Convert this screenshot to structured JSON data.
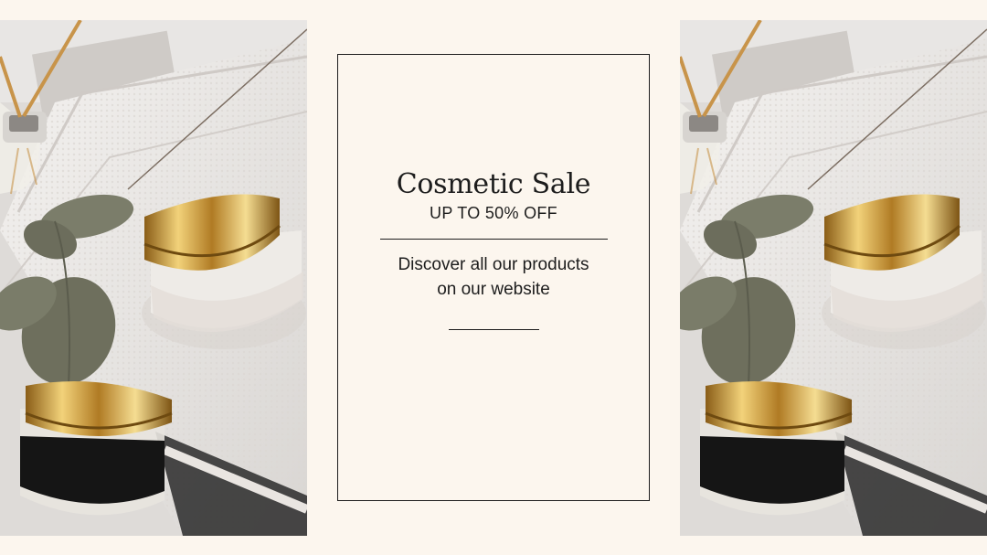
{
  "promo": {
    "title": "Cosmetic Sale",
    "subtitle": "UP TO 50% OFF",
    "line1": "Discover all our products",
    "line2": "on our website"
  },
  "colors": {
    "background": "#fcf6ee",
    "text": "#1d1d1d",
    "gold": "#c9a24a"
  },
  "images": [
    {
      "subject": "cosmetic-jars-on-towel-photo"
    },
    {
      "subject": "cosmetic-jars-on-towel-photo"
    }
  ]
}
